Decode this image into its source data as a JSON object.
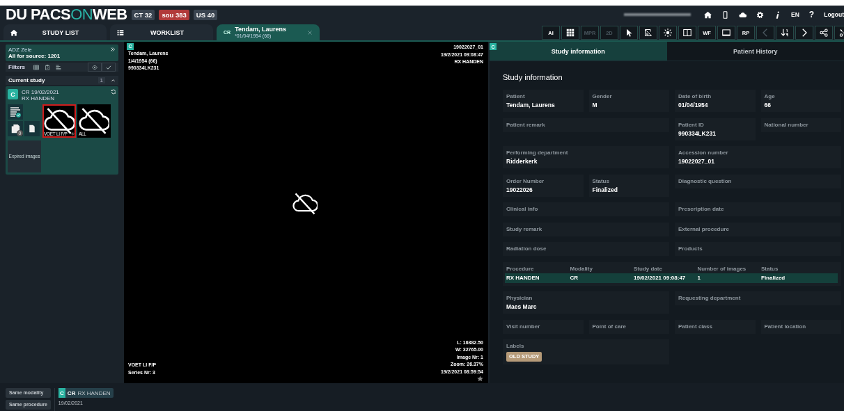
{
  "header": {
    "logo": [
      {
        "text": "DU PACS",
        "kind": "plain"
      },
      {
        "text": "ON",
        "kind": "accent"
      },
      {
        "text": "WEB",
        "kind": "plain"
      }
    ],
    "badges": [
      {
        "text": "CT 32",
        "color": "#3a4450"
      },
      {
        "text": "sou 383",
        "color": "#b13a3a"
      },
      {
        "text": "US 40",
        "color": "#3a4450"
      }
    ],
    "language": "EN",
    "help": "?",
    "logout": "Logout"
  },
  "tabs": [
    {
      "label": "STUDY LIST",
      "kind": "home",
      "selected": false
    },
    {
      "label": "WORKLIST",
      "kind": "list",
      "selected": false
    },
    {
      "label": "Tendam, Laurens",
      "sub": "*01/04/1954 (66)",
      "badge": "CR",
      "kind": "patient",
      "selected": true
    }
  ],
  "toolbar": [
    {
      "kind": "text",
      "label": "AI",
      "disabled": false
    },
    {
      "kind": "icon",
      "disabled": false
    },
    {
      "kind": "text",
      "label": "MPR",
      "disabled": true
    },
    {
      "kind": "text",
      "label": "2D",
      "disabled": true
    },
    {
      "kind": "icon",
      "disabled": false
    },
    {
      "kind": "icon",
      "disabled": false
    },
    {
      "kind": "icon",
      "disabled": false
    },
    {
      "kind": "icon",
      "disabled": false
    },
    {
      "kind": "text",
      "label": "WF",
      "disabled": false
    },
    {
      "kind": "icon",
      "disabled": false
    },
    {
      "kind": "text",
      "label": "RP",
      "disabled": false
    },
    {
      "kind": "icon",
      "disabled": true
    },
    {
      "kind": "icon",
      "disabled": false
    },
    {
      "kind": "icon",
      "disabled": false
    },
    {
      "kind": "icon",
      "disabled": false
    },
    {
      "kind": "icon",
      "disabled": false
    }
  ],
  "sidebar": {
    "source": "ADZ Zele",
    "summary": "All for source: **1201**",
    "filters_label": "Filters",
    "current_study": {
      "title": "Current study",
      "count": "1",
      "expanded": true,
      "badge": "C",
      "line1": "CR 19/02/2021",
      "line2": "RX HANDEN",
      "copies": "0",
      "series": [
        {
          "label": "VOET LI F/P",
          "selected": true
        },
        {
          "label": "ALL",
          "selected": false
        }
      ],
      "expired": "Expired images"
    }
  },
  "viewer": {
    "badge": "C",
    "top_left": [
      "Tendam, Laurens",
      "1/4/1954 (66)",
      "990334LK231"
    ],
    "top_right": [
      "19022027_01",
      "19/2/2021 09:08:47",
      "RX HANDEN"
    ],
    "bottom_left": [
      "VOET LI F/P",
      "Series Nr: 3"
    ],
    "bottom_right": [
      "L: 16382.50",
      "W: 32765.00",
      "Image Nr: 1",
      "Zoom: 26.37%",
      "19/2/2021 08:59:54"
    ]
  },
  "info": {
    "badge": "C",
    "tabs": [
      {
        "label": "Study information",
        "selected": true
      },
      {
        "label": "Patient History",
        "selected": false
      }
    ],
    "heading": "Study information",
    "items": [
      {
        "kind": "fields",
        "left": [
          {
            "label": "Patient",
            "value": "Tendam, Laurens"
          },
          {
            "label": "Gender",
            "value": "M"
          }
        ],
        "right": [
          {
            "label": "Date of birth",
            "value": "01/04/1954"
          },
          {
            "label": "Age",
            "value": "66"
          }
        ]
      },
      {
        "kind": "fields",
        "left": [
          {
            "label": "Patient remark"
          }
        ],
        "right": [
          {
            "label": "Patient ID",
            "value": "990334LK231"
          },
          {
            "label": "National number"
          }
        ]
      },
      {
        "kind": "fields",
        "left": [
          {
            "label": "Performing department",
            "value": "Ridderkerk"
          }
        ],
        "right": [
          {
            "label": "Accession number",
            "value": "19022027_01"
          }
        ]
      },
      {
        "kind": "fields",
        "left": [
          {
            "label": "Order Number",
            "value": "19022026"
          },
          {
            "label": "Status",
            "value": "Finalized"
          }
        ],
        "right": [
          {
            "label": "Diagnostic question"
          }
        ]
      },
      {
        "kind": "fields",
        "left": [
          {
            "label": "Clinical info"
          }
        ],
        "right": [
          {
            "label": "Prescription date"
          }
        ]
      },
      {
        "kind": "fields",
        "left": [
          {
            "label": "Study remark"
          }
        ],
        "right": [
          {
            "label": "External procedure"
          }
        ]
      },
      {
        "kind": "fields",
        "left": [
          {
            "label": "Radiation dose"
          }
        ],
        "right": [
          {
            "label": "Products"
          }
        ]
      },
      {
        "kind": "table",
        "columns": [
          "Procedure",
          "Modality",
          "Study date",
          "Number of images",
          "Status"
        ],
        "rows": [
          {
            "cells": [
              "RX HANDEN",
              "CR",
              "19/02/2021 09:08:47",
              "1",
              "Finalized"
            ],
            "selected": true
          }
        ]
      },
      {
        "kind": "fields",
        "left": [
          {
            "label": "Physician",
            "value": "Maes Marc"
          }
        ],
        "right": [
          {
            "label": "Requesting department"
          }
        ]
      },
      {
        "kind": "fields",
        "left": [
          {
            "label": "Visit number"
          },
          {
            "label": "Point of care"
          }
        ],
        "right": [
          {
            "label": "Patient class"
          },
          {
            "label": "Patient location"
          }
        ]
      },
      {
        "kind": "fields",
        "left": [
          {
            "label": "Labels",
            "tags": [
              "OLD STUDY"
            ]
          }
        ]
      }
    ]
  },
  "bottom": {
    "buttons": [
      "Same modality",
      "Same procedure"
    ],
    "study": {
      "badge": "C",
      "modality": "CR",
      "name": "RX HANDEN",
      "date": "19/02/2021"
    }
  }
}
